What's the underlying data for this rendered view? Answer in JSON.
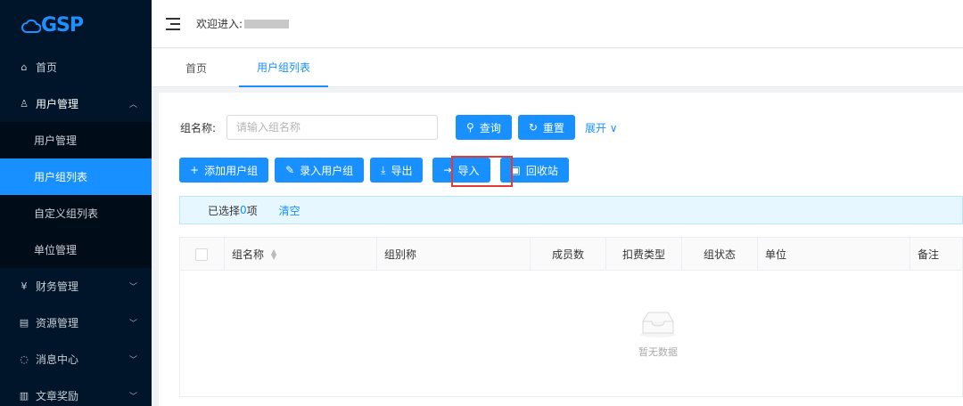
{
  "sidebar": {
    "logo": "GSP",
    "items": [
      {
        "label": "首页",
        "icon": "home-icon"
      },
      {
        "label": "用户管理",
        "icon": "user-icon",
        "open": true
      },
      {
        "label": "财务管理",
        "icon": "finance-icon"
      },
      {
        "label": "资源管理",
        "icon": "resource-icon"
      },
      {
        "label": "消息中心",
        "icon": "message-icon"
      },
      {
        "label": "文章奖励",
        "icon": "article-icon"
      }
    ],
    "submenu": [
      {
        "label": "用户管理"
      },
      {
        "label": "用户组列表",
        "active": true
      },
      {
        "label": "自定义组列表"
      },
      {
        "label": "单位管理"
      }
    ]
  },
  "header": {
    "welcome": "欢迎进入:"
  },
  "tabs": [
    {
      "label": "首页"
    },
    {
      "label": "用户组列表",
      "active": true
    }
  ],
  "search": {
    "label": "组名称:",
    "placeholder": "请输入组名称",
    "query_label": "查询",
    "reset_label": "重置",
    "expand_label": "展开"
  },
  "actions": {
    "add": "添加用户组",
    "enter": "录入用户组",
    "export": "导出",
    "import": "导入",
    "recycle": "回收站"
  },
  "selection": {
    "prefix": "已选择",
    "count": "0",
    "suffix": "项",
    "clear": "清空"
  },
  "table": {
    "columns": [
      "组名称",
      "组别称",
      "成员数",
      "扣费类型",
      "组状态",
      "单位",
      "备注"
    ],
    "empty_text": "暂无数据"
  },
  "colors": {
    "primary": "#1890ff",
    "sidebar_bg": "#001529",
    "highlight": "#e53935"
  }
}
